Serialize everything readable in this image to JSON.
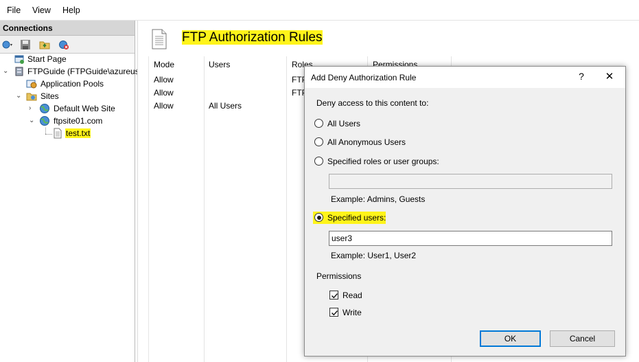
{
  "menu": {
    "items": [
      "File",
      "View",
      "Help"
    ]
  },
  "connections": {
    "header": "Connections",
    "tree": {
      "start_page": "Start Page",
      "server": "FTPGuide (FTPGuide\\azureuse",
      "app_pools": "Application Pools",
      "sites": "Sites",
      "default_site": "Default Web Site",
      "ftp_site": "ftpsite01.com",
      "file": "test.txt"
    }
  },
  "main": {
    "title": "FTP Authorization Rules",
    "columns": [
      "Mode",
      "Users",
      "Roles",
      "Permissions"
    ],
    "rows": [
      {
        "mode": "Allow",
        "users": "",
        "roles": "FTPU"
      },
      {
        "mode": "Allow",
        "users": "",
        "roles": "FTPU"
      },
      {
        "mode": "Allow",
        "users": "All Users",
        "roles": ""
      }
    ]
  },
  "dialog": {
    "title": "Add Deny Authorization Rule",
    "help": "?",
    "close": "✕",
    "prompt": "Deny access to this content to:",
    "options": {
      "all_users": "All Users",
      "all_anonymous": "All Anonymous Users",
      "specified_roles": "Specified roles or user groups:",
      "specified_users": "Specified users:"
    },
    "selected_option": "specified_users",
    "roles_value": "",
    "roles_example": "Example: Admins, Guests",
    "users_value": "user3",
    "users_example": "Example: User1, User2",
    "permissions_label": "Permissions",
    "permissions": {
      "read": "Read",
      "write": "Write",
      "read_checked": true,
      "write_checked": true
    },
    "ok": "OK",
    "cancel": "Cancel"
  },
  "colors": {
    "highlight": "#fff41a",
    "accent": "#0078d7",
    "dialog_bg": "#f0f0f0"
  }
}
